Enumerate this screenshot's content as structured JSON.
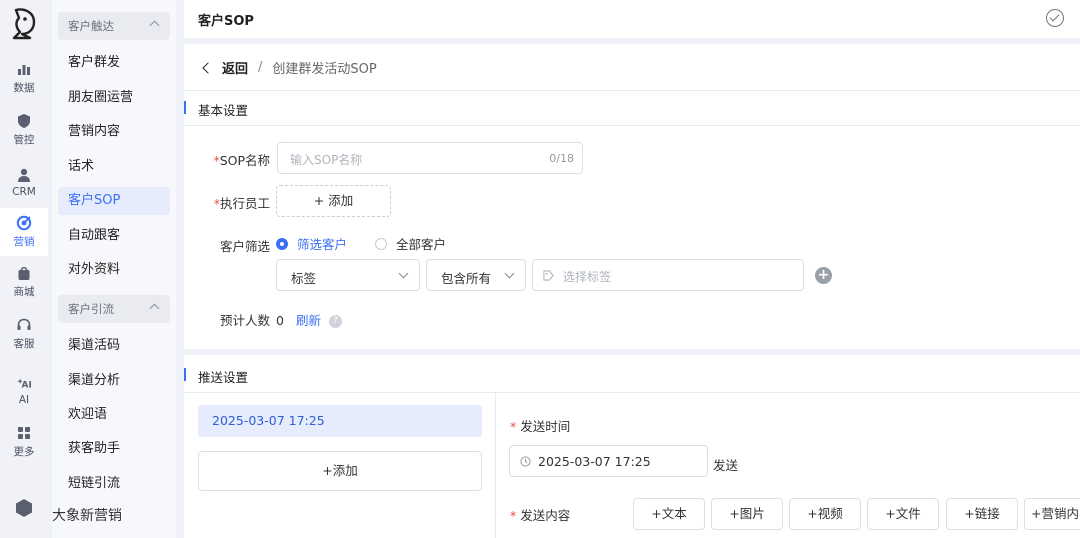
{
  "rail": {
    "items": [
      {
        "label": "数据",
        "icon": "bar-chart-icon"
      },
      {
        "label": "管控",
        "icon": "shield-icon"
      },
      {
        "label": "CRM",
        "icon": "person-icon"
      },
      {
        "label": "营销",
        "icon": "target-icon"
      },
      {
        "label": "商城",
        "icon": "bag-icon"
      },
      {
        "label": "客服",
        "icon": "headset-icon"
      },
      {
        "label": "AI",
        "icon": "ai-sparkle-icon"
      },
      {
        "label": "更多",
        "icon": "grid-icon"
      }
    ],
    "active": "营销",
    "accent": "#3b6ff5"
  },
  "submenu": {
    "group1": "客户触达",
    "group1_items": [
      "客户群发",
      "朋友圈运营",
      "营销内容",
      "话术",
      "客户SOP",
      "自动跟客",
      "对外资料"
    ],
    "group2": "客户引流",
    "group2_items": [
      "渠道活码",
      "渠道分析",
      "欢迎语",
      "获客助手",
      "短链引流"
    ],
    "active": "客户SOP",
    "overlay_text": "大象新营销"
  },
  "topbar": {
    "title": "客户SOP"
  },
  "breadcrumb": {
    "back": "返回",
    "separator": "/",
    "current": "创建群发活动SOP"
  },
  "basic": {
    "title": "基本设置",
    "sop_name_label": "SOP名称",
    "sop_name_placeholder": "输入SOP名称",
    "sop_name_count": "0/18",
    "staff_label": "执行员工",
    "staff_add": "+ 添加",
    "filter_label": "客户筛选",
    "filter_option_selected": "筛选客户",
    "filter_option_other": "全部客户",
    "tag_select": "标签",
    "match_select": "包含所有",
    "tag_placeholder": "选择标签",
    "estimate_label": "预计人数",
    "estimate_value": "0",
    "refresh": "刷新",
    "required_mark": "*"
  },
  "push": {
    "title": "推送设置",
    "date_item": "2025-03-07 17:25",
    "add_button": "+添加",
    "send_time_label": "发送时间",
    "send_time_value": "2025-03-07 17:25",
    "send_suffix": "发送",
    "content_label": "发送内容",
    "content_buttons": [
      "+文本",
      "+图片",
      "+视频",
      "+文件",
      "+链接",
      "+营销内"
    ]
  }
}
